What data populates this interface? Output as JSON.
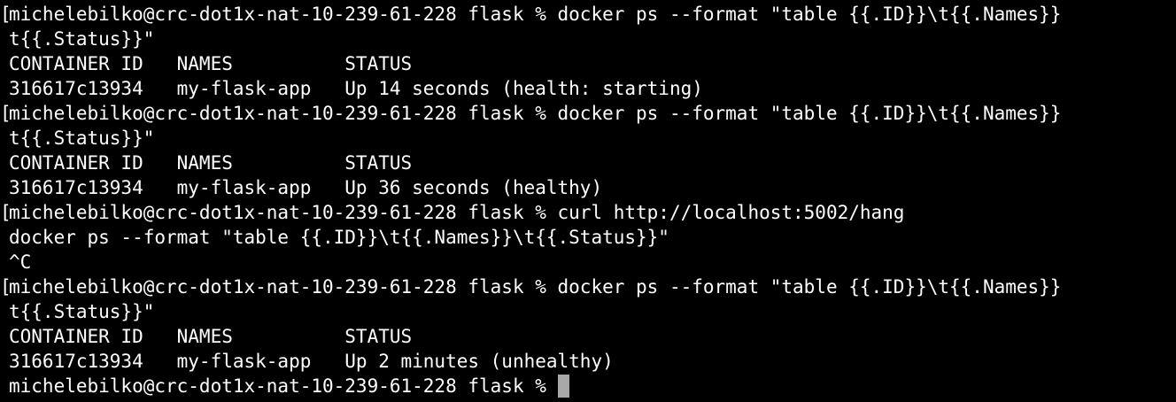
{
  "terminal": {
    "lines": [
      {
        "bracket": true,
        "text": "michelebilko@crc-dot1x-nat-10-239-61-228 flask % docker ps --format \"table {{.ID}}\\t{{.Names}}"
      },
      {
        "bracket": false,
        "text": "t{{.Status}}\""
      },
      {
        "bracket": false,
        "text": "CONTAINER ID   NAMES          STATUS"
      },
      {
        "bracket": false,
        "text": "316617c13934   my-flask-app   Up 14 seconds (health: starting)"
      },
      {
        "bracket": true,
        "text": "michelebilko@crc-dot1x-nat-10-239-61-228 flask % docker ps --format \"table {{.ID}}\\t{{.Names}}"
      },
      {
        "bracket": false,
        "text": "t{{.Status}}\""
      },
      {
        "bracket": false,
        "text": "CONTAINER ID   NAMES          STATUS"
      },
      {
        "bracket": false,
        "text": "316617c13934   my-flask-app   Up 36 seconds (healthy)"
      },
      {
        "bracket": true,
        "text": "michelebilko@crc-dot1x-nat-10-239-61-228 flask % curl http://localhost:5002/hang"
      },
      {
        "bracket": false,
        "text": "docker ps --format \"table {{.ID}}\\t{{.Names}}\\t{{.Status}}\""
      },
      {
        "bracket": false,
        "text": "^C"
      },
      {
        "bracket": true,
        "text": "michelebilko@crc-dot1x-nat-10-239-61-228 flask % docker ps --format \"table {{.ID}}\\t{{.Names}}"
      },
      {
        "bracket": false,
        "text": "t{{.Status}}\""
      },
      {
        "bracket": false,
        "text": "CONTAINER ID   NAMES          STATUS"
      },
      {
        "bracket": false,
        "text": "316617c13934   my-flask-app   Up 2 minutes (unhealthy)"
      }
    ],
    "prompt": "michelebilko@crc-dot1x-nat-10-239-61-228 flask % ",
    "bracket_char": "[",
    "colors": {
      "background": "#000000",
      "foreground": "#ffffff",
      "cursor": "#a8a8a8"
    }
  }
}
